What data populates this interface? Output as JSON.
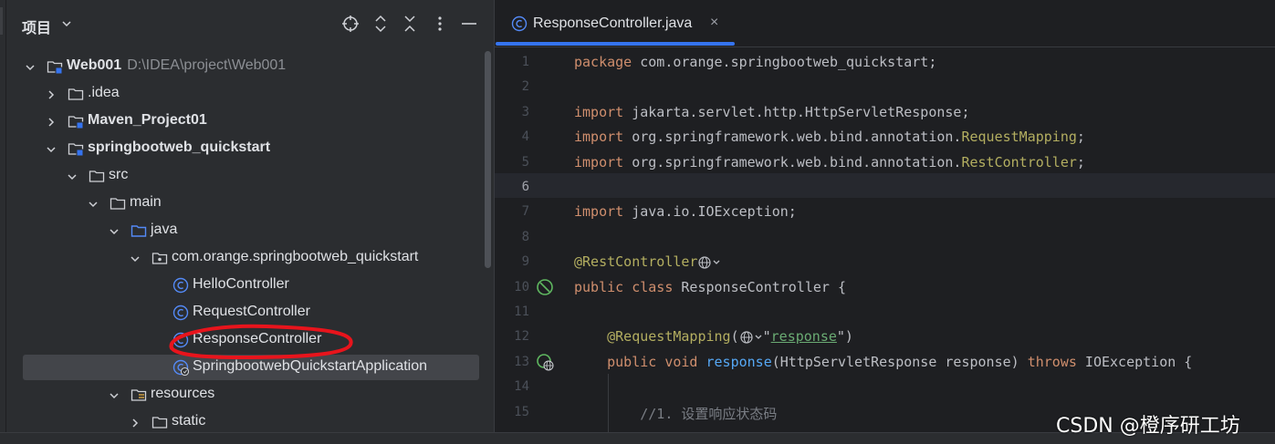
{
  "panel": {
    "title": "项目",
    "tree": [
      {
        "label": "Web001",
        "path": "D:\\IDEA\\project\\Web001",
        "bold": true,
        "type": "module-folder",
        "expanded": true,
        "depth": 0
      },
      {
        "label": ".idea",
        "bold": false,
        "type": "folder",
        "expanded": false,
        "depth": 1
      },
      {
        "label": "Maven_Project01",
        "bold": true,
        "type": "module-folder",
        "expanded": false,
        "depth": 1
      },
      {
        "label": "springbootweb_quickstart",
        "bold": true,
        "type": "module-folder",
        "expanded": true,
        "depth": 1
      },
      {
        "label": "src",
        "bold": false,
        "type": "folder",
        "expanded": true,
        "depth": 2
      },
      {
        "label": "main",
        "bold": false,
        "type": "folder",
        "expanded": true,
        "depth": 3
      },
      {
        "label": "java",
        "bold": false,
        "type": "source-folder",
        "expanded": true,
        "depth": 4
      },
      {
        "label": "com.orange.springbootweb_quickstart",
        "bold": false,
        "type": "package",
        "expanded": true,
        "depth": 5
      },
      {
        "label": "HelloController",
        "bold": false,
        "type": "class",
        "depth": 6
      },
      {
        "label": "RequestController",
        "bold": false,
        "type": "class",
        "depth": 6
      },
      {
        "label": "ResponseController",
        "bold": false,
        "type": "class",
        "depth": 6,
        "circled": true
      },
      {
        "label": "SpringbootwebQuickstartApplication",
        "bold": false,
        "type": "spring-class",
        "depth": 6,
        "selected": true
      },
      {
        "label": "resources",
        "bold": false,
        "type": "resource-folder",
        "expanded": true,
        "depth": 4
      },
      {
        "label": "static",
        "bold": false,
        "type": "folder",
        "expanded": false,
        "depth": 5
      }
    ]
  },
  "editor": {
    "tab": {
      "label": "ResponseController.java",
      "close": "×"
    },
    "current_line": 6,
    "lines": [
      {
        "n": "1",
        "code": "package com.orange.springbootweb_quickstart;"
      },
      {
        "n": "2",
        "code": ""
      },
      {
        "n": "3",
        "code": "import jakarta.servlet.http.HttpServletResponse;"
      },
      {
        "n": "4",
        "code": "import org.springframework.web.bind.annotation.RequestMapping;"
      },
      {
        "n": "5",
        "code": "import org.springframework.web.bind.annotation.RestController;"
      },
      {
        "n": "6",
        "code": ""
      },
      {
        "n": "7",
        "code": "import java.io.IOException;"
      },
      {
        "n": "8",
        "code": ""
      },
      {
        "n": "9",
        "code": "@RestController"
      },
      {
        "n": "10",
        "code": "public class ResponseController {"
      },
      {
        "n": "11",
        "code": ""
      },
      {
        "n": "12",
        "code": "    @RequestMapping(\"response\")"
      },
      {
        "n": "13",
        "code": "    public void response(HttpServletResponse response) throws IOException {"
      },
      {
        "n": "14",
        "code": ""
      },
      {
        "n": "15",
        "code": "        //1. 设置响应状态码"
      }
    ]
  },
  "watermark": "CSDN @橙序研工坊",
  "colors": {
    "accent": "#3574f0",
    "keyword": "#cf8e6d",
    "annotation": "#b3ae60",
    "method": "#56a8f5",
    "string": "#6aab73",
    "comment": "#7a7e85",
    "circle_mark": "#e8141c"
  }
}
